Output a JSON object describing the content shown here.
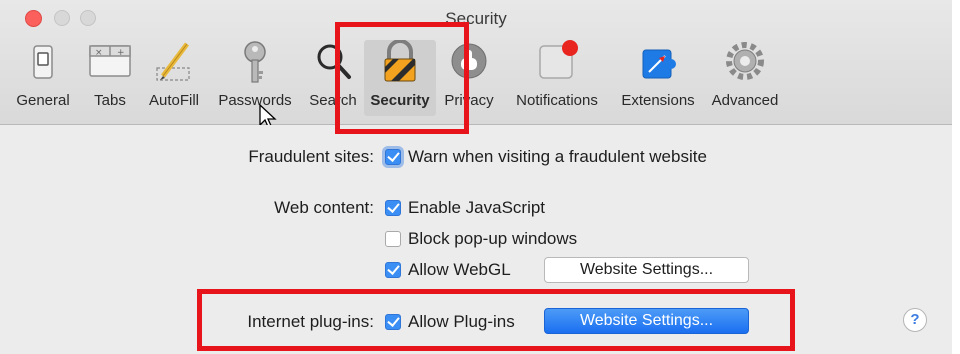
{
  "window": {
    "title": "Security"
  },
  "toolbar": {
    "items": [
      {
        "label": "General",
        "icon": "general-switch-icon"
      },
      {
        "label": "Tabs",
        "icon": "tabs-icon"
      },
      {
        "label": "AutoFill",
        "icon": "autofill-pencil-icon"
      },
      {
        "label": "Passwords",
        "icon": "key-icon"
      },
      {
        "label": "Search",
        "icon": "magnifier-icon"
      },
      {
        "label": "Security",
        "icon": "padlock-icon",
        "selected": true
      },
      {
        "label": "Privacy",
        "icon": "privacy-hand-icon"
      },
      {
        "label": "Notifications",
        "icon": "notifications-icon"
      },
      {
        "label": "Extensions",
        "icon": "extensions-puzzle-icon"
      },
      {
        "label": "Advanced",
        "icon": "gear-icon"
      }
    ]
  },
  "fraudulent": {
    "label": "Fraudulent sites:",
    "checkbox_label": "Warn when visiting a fraudulent website",
    "checked": true
  },
  "web_content": {
    "label": "Web content:",
    "enable_js": {
      "label": "Enable JavaScript",
      "checked": true
    },
    "block_popups": {
      "label": "Block pop-up windows",
      "checked": false
    },
    "allow_webgl": {
      "label": "Allow WebGL",
      "checked": true
    },
    "website_settings_button": "Website Settings..."
  },
  "plugins": {
    "label": "Internet plug-ins:",
    "allow_plugins": {
      "label": "Allow Plug-ins",
      "checked": true
    },
    "website_settings_button": "Website Settings..."
  },
  "help": {
    "glyph": "?"
  },
  "colors": {
    "accent": "#3b8ef3",
    "annotation_red": "#e8141b",
    "window_bg": "#ececec"
  }
}
